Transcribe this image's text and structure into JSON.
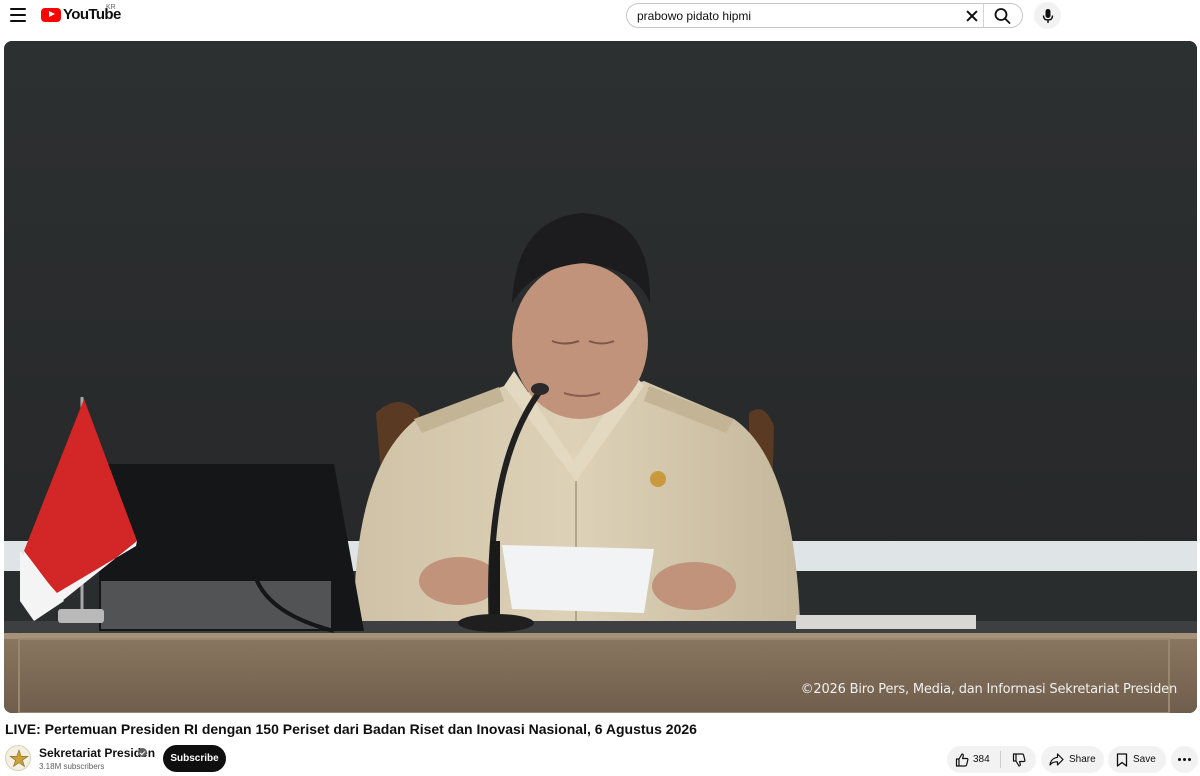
{
  "header": {
    "logo_text": "YouTube",
    "region": "KR",
    "search_query": "prabowo pidato hipmi",
    "icons": [
      "menu-icon",
      "youtube-logo-icon",
      "clear-icon",
      "search-icon",
      "microphone-icon"
    ]
  },
  "player": {
    "watermark": "©2026 Biro Pers, Media, dan Informasi Sekretariat Presiden"
  },
  "video": {
    "title": "LIVE: Pertemuan Presiden RI dengan 150 Periset dari Badan Riset dan Inovasi Nasional, 6 Agustus 2026"
  },
  "channel": {
    "name": "Sekretariat Presiden",
    "subscribers": "3.18M subscribers",
    "subscribe_label": "Subscribe"
  },
  "actions": {
    "like_count": "384",
    "share_label": "Share",
    "save_label": "Save"
  },
  "colors": {
    "brand_red": "#ff0000",
    "subscribe_bg": "#0f0f0f",
    "pill_bg": "#f2f2f2"
  }
}
